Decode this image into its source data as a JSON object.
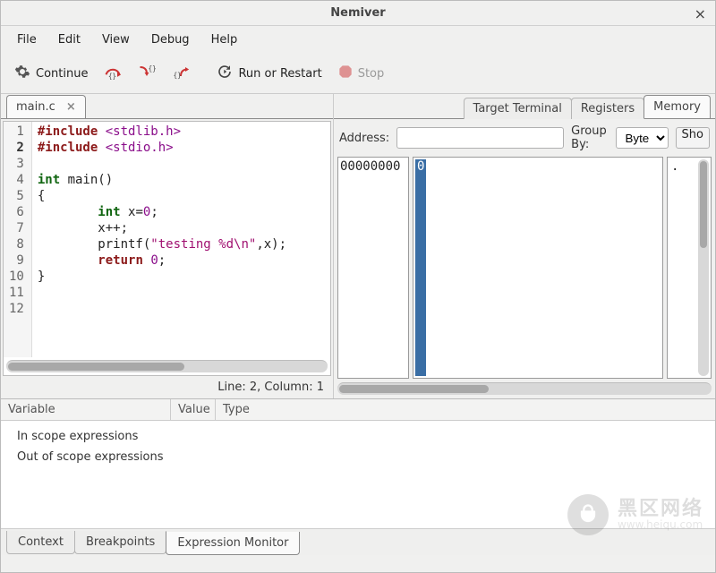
{
  "window": {
    "title": "Nemiver"
  },
  "menubar": [
    "File",
    "Edit",
    "View",
    "Debug",
    "Help"
  ],
  "toolbar": {
    "continue": "Continue",
    "run_restart": "Run or Restart",
    "stop": "Stop"
  },
  "source_tabs": [
    {
      "label": "main.c",
      "closable": true
    }
  ],
  "editor": {
    "status": "Line: 2, Column: 1",
    "current_line": 2,
    "lines": [
      {
        "n": 1,
        "segments": [
          {
            "t": "#include ",
            "c": "kw"
          },
          {
            "t": "<stdlib.h>",
            "c": "inc"
          }
        ]
      },
      {
        "n": 2,
        "segments": [
          {
            "t": "#include ",
            "c": "kw"
          },
          {
            "t": "<stdio.h>",
            "c": "inc"
          }
        ]
      },
      {
        "n": 3,
        "segments": []
      },
      {
        "n": 4,
        "segments": [
          {
            "t": "int ",
            "c": "ty"
          },
          {
            "t": "main()",
            "c": ""
          }
        ]
      },
      {
        "n": 5,
        "segments": [
          {
            "t": "{",
            "c": ""
          }
        ]
      },
      {
        "n": 6,
        "segments": [
          {
            "t": "        ",
            "c": ""
          },
          {
            "t": "int ",
            "c": "ty"
          },
          {
            "t": "x=",
            "c": ""
          },
          {
            "t": "0",
            "c": "num"
          },
          {
            "t": ";",
            "c": ""
          }
        ]
      },
      {
        "n": 7,
        "segments": [
          {
            "t": "        x++;",
            "c": ""
          }
        ]
      },
      {
        "n": 8,
        "segments": [
          {
            "t": "        printf(",
            "c": ""
          },
          {
            "t": "\"testing %d\\n\"",
            "c": "str"
          },
          {
            "t": ",x);",
            "c": ""
          }
        ]
      },
      {
        "n": 9,
        "segments": [
          {
            "t": "        ",
            "c": ""
          },
          {
            "t": "return ",
            "c": "kw"
          },
          {
            "t": "0",
            "c": "num"
          },
          {
            "t": ";",
            "c": ""
          }
        ]
      },
      {
        "n": 10,
        "segments": [
          {
            "t": "}",
            "c": ""
          }
        ]
      },
      {
        "n": 11,
        "segments": []
      },
      {
        "n": 12,
        "segments": []
      }
    ]
  },
  "right_tabs": {
    "items": [
      "Target Terminal",
      "Registers",
      "Memory"
    ],
    "active": 2
  },
  "memory": {
    "address_label": "Address:",
    "address_value": "",
    "groupby_label": "Group By:",
    "groupby_value": "Byte",
    "show_label": "Sho",
    "addr_col": "00000000",
    "hex_first": "0",
    "ascii_col": "."
  },
  "bottom": {
    "columns": [
      "Variable",
      "Value",
      "Type"
    ],
    "rows": [
      "In scope expressions",
      "Out of scope expressions"
    ],
    "tabs": {
      "items": [
        "Context",
        "Breakpoints",
        "Expression Monitor"
      ],
      "active": 2
    }
  },
  "watermark": {
    "big": "黑区网络",
    "small": "www.heiqu.com"
  }
}
